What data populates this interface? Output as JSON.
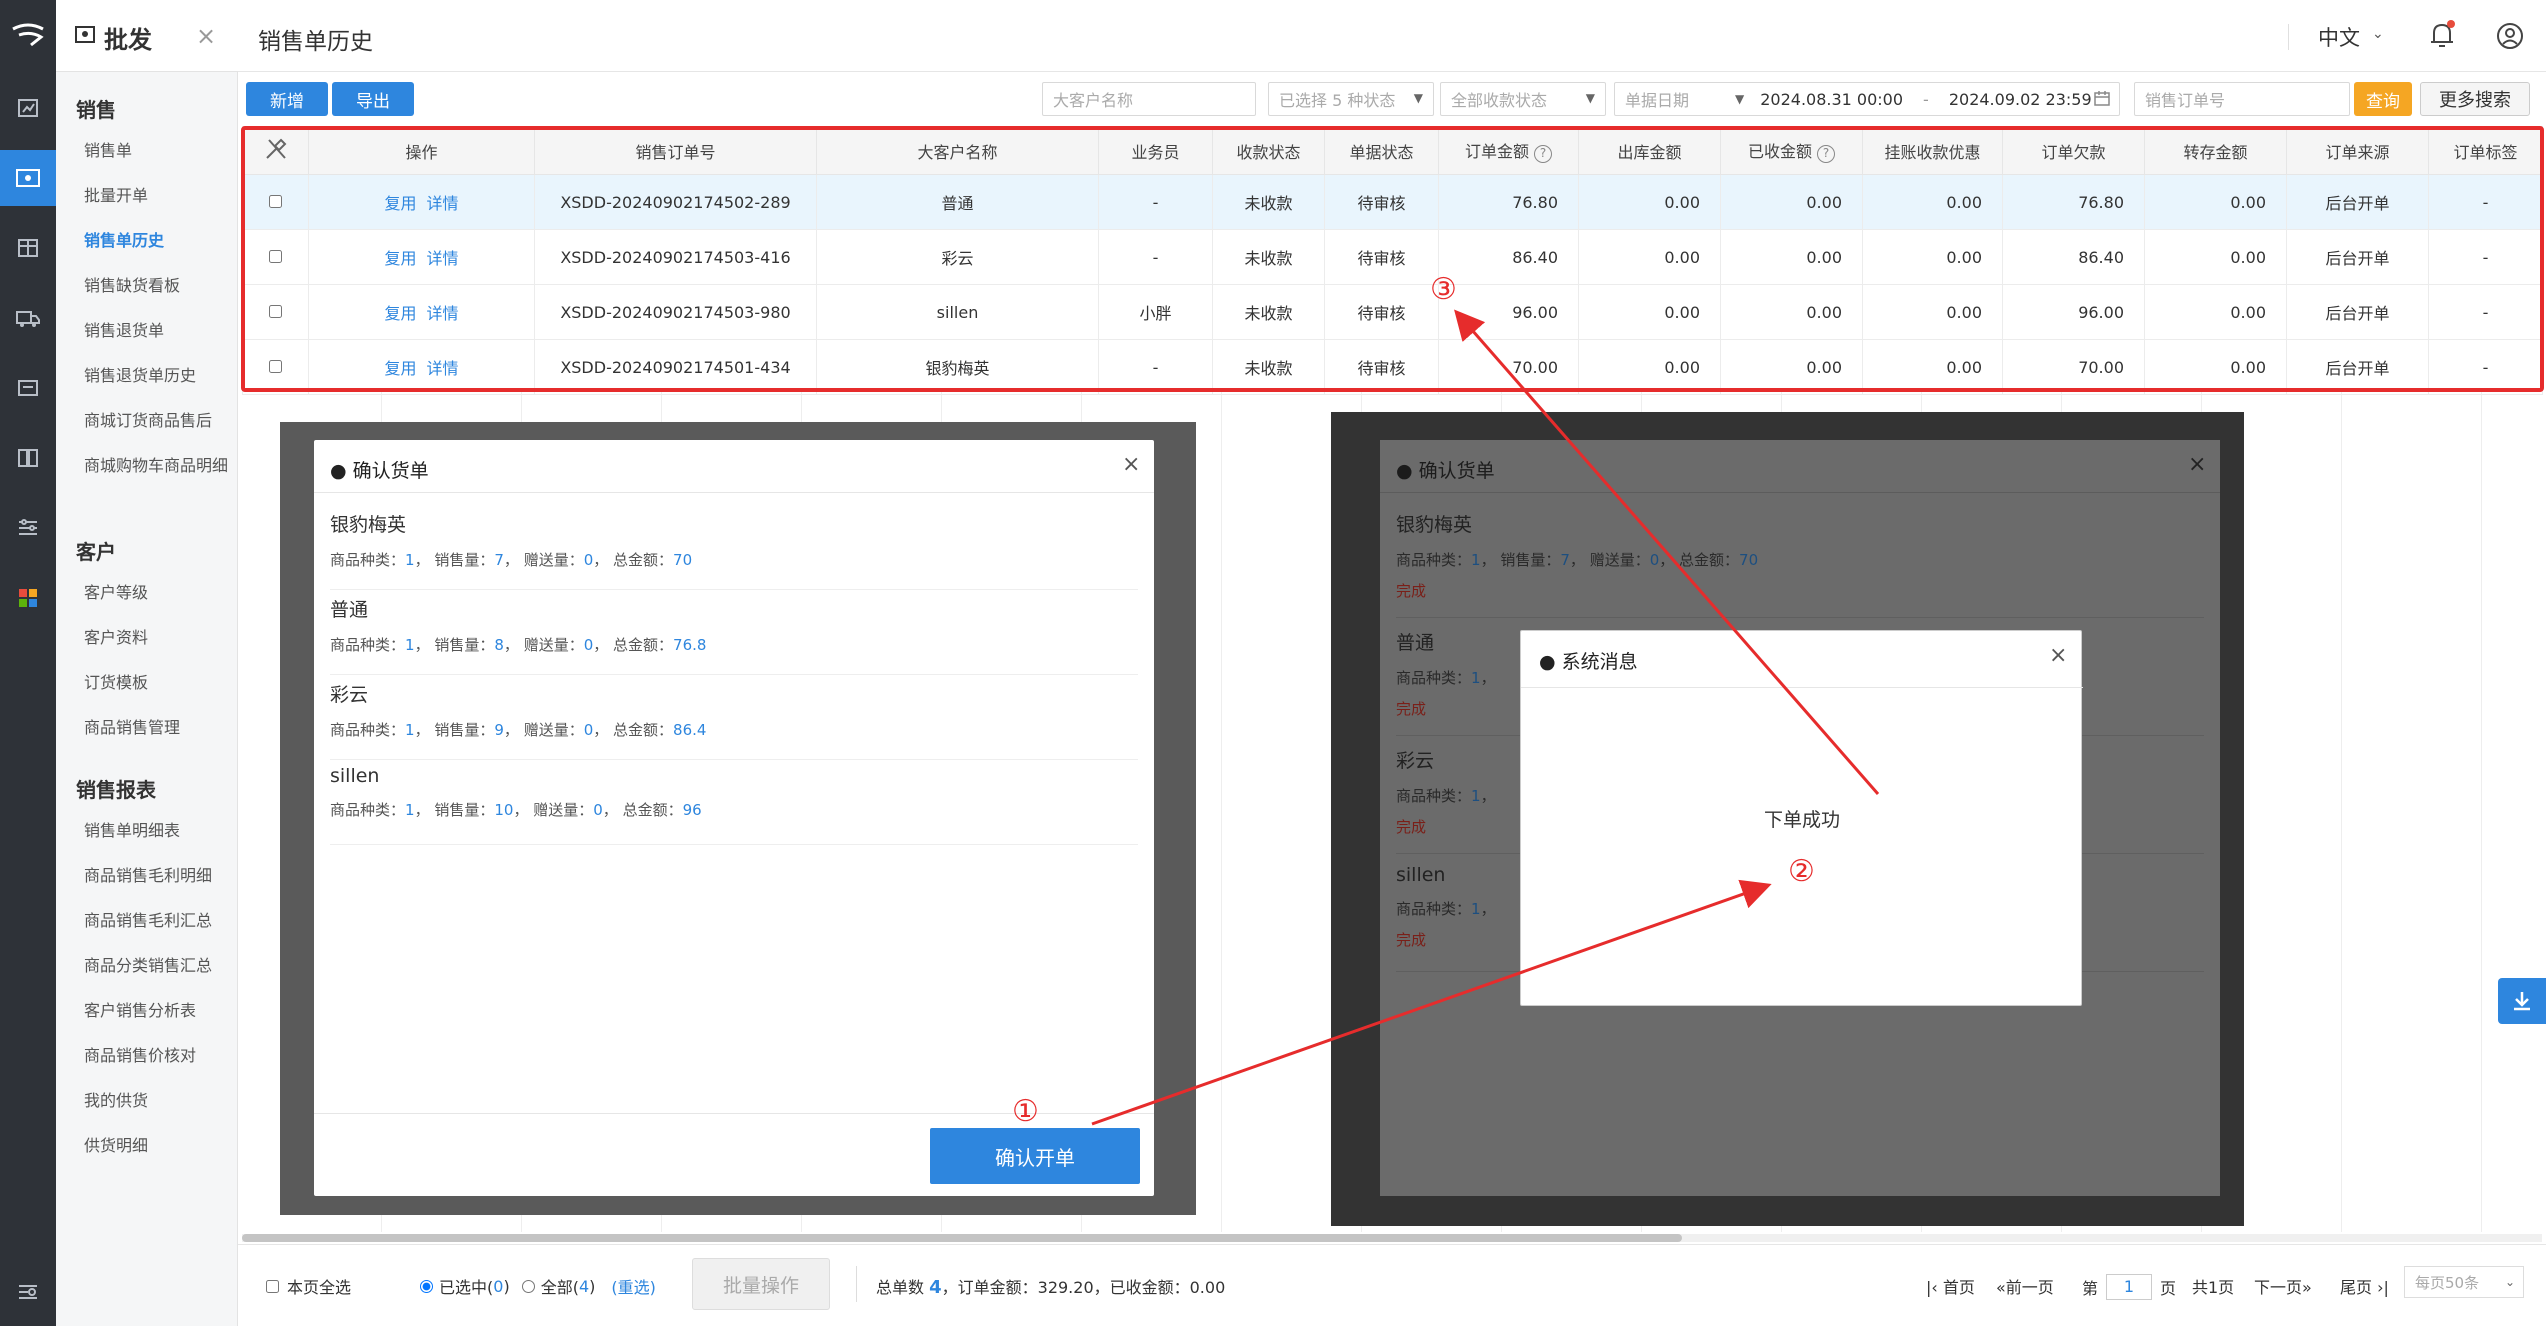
{
  "app": {
    "module_title": "批发",
    "lang": "中文"
  },
  "sidebar": {
    "groups": [
      {
        "title": "销售",
        "items": [
          "销售单",
          "批量开单",
          "销售单历史",
          "销售缺货看板",
          "销售退货单",
          "销售退货单历史",
          "商城订货商品售后",
          "商城购物车商品明细"
        ]
      },
      {
        "title": "客户",
        "items": [
          "客户等级",
          "客户资料",
          "订货模板",
          "商品销售管理"
        ]
      },
      {
        "title": "销售报表",
        "items": [
          "销售单明细表",
          "商品销售毛利明细",
          "商品销售毛利汇总",
          "商品分类销售汇总",
          "客户销售分析表",
          "商品销售价核对",
          "我的供货",
          "供货明细"
        ]
      }
    ]
  },
  "header": {
    "title": "销售单历史"
  },
  "toolbar": {
    "add_label": "新增",
    "export_label": "导出",
    "customer_placeholder": "大客户名称",
    "status_selected": "已选择 5 种状态",
    "payment_status": "全部收款状态",
    "date_type": "单据日期",
    "date_from": "2024.08.31 00:00",
    "date_sep": "-",
    "date_to": "2024.09.02 23:59",
    "order_no_placeholder": "销售订单号",
    "query_label": "查询",
    "more_search_label": "更多搜索"
  },
  "table": {
    "headers": [
      "",
      "操作",
      "销售订单号",
      "大客户名称",
      "业务员",
      "收款状态",
      "单据状态",
      "订单金额",
      "出库金额",
      "已收金额",
      "挂账收款优惠",
      "订单欠款",
      "转存金额",
      "订单来源",
      "订单标签"
    ],
    "action_reuse": "复用",
    "action_detail": "详情",
    "rows": [
      {
        "order_no": "XSDD-20240902174502-289",
        "customer": "普通",
        "salesman": "-",
        "pay_status": "未收款",
        "doc_status": "待审核",
        "amount": "76.80",
        "out_amount": "0.00",
        "received": "0.00",
        "discount": "0.00",
        "debt": "76.80",
        "transfer": "0.00",
        "source": "后台开单",
        "tag": "-"
      },
      {
        "order_no": "XSDD-20240902174503-416",
        "customer": "彩云",
        "salesman": "-",
        "pay_status": "未收款",
        "doc_status": "待审核",
        "amount": "86.40",
        "out_amount": "0.00",
        "received": "0.00",
        "discount": "0.00",
        "debt": "86.40",
        "transfer": "0.00",
        "source": "后台开单",
        "tag": "-"
      },
      {
        "order_no": "XSDD-20240902174503-980",
        "customer": "sillen",
        "salesman": "小胖",
        "pay_status": "未收款",
        "doc_status": "待审核",
        "amount": "96.00",
        "out_amount": "0.00",
        "received": "0.00",
        "discount": "0.00",
        "debt": "96.00",
        "transfer": "0.00",
        "source": "后台开单",
        "tag": "-"
      },
      {
        "order_no": "XSDD-20240902174501-434",
        "customer": "银豹梅英",
        "salesman": "-",
        "pay_status": "未收款",
        "doc_status": "待审核",
        "amount": "70.00",
        "out_amount": "0.00",
        "received": "0.00",
        "discount": "0.00",
        "debt": "70.00",
        "transfer": "0.00",
        "source": "后台开单",
        "tag": "-"
      }
    ]
  },
  "confirm_dialog": {
    "title": "● 确认货单",
    "customers": [
      {
        "name": "银豹梅英",
        "kinds": "1",
        "qty": "7",
        "gift": "0",
        "total": "70"
      },
      {
        "name": "普通",
        "kinds": "1",
        "qty": "8",
        "gift": "0",
        "total": "76.8"
      },
      {
        "name": "彩云",
        "kinds": "1",
        "qty": "9",
        "gift": "0",
        "total": "86.4"
      },
      {
        "name": "sillen",
        "kinds": "1",
        "qty": "10",
        "gift": "0",
        "total": "96"
      }
    ],
    "labels": {
      "kinds": "商品种类：",
      "qty": "销售量：",
      "gift": "赠送量：",
      "total": "总金额："
    },
    "confirm_label": "确认开单",
    "done_label": "完成"
  },
  "system_dialog": {
    "title": "● 系统消息",
    "message": "下单成功"
  },
  "annotations": {
    "step1": "①",
    "step2": "②",
    "step3": "③"
  },
  "footer": {
    "select_page": "本页全选",
    "selected": "已选中(",
    "selected_count": "0",
    "all": "全部(",
    "all_count": "4",
    "close_paren": ")",
    "reselect": "(重选)",
    "batch_label": "批量操作",
    "summary_prefix": "总单数",
    "summary_count": "4",
    "summary_rest": "，订单金额：329.20，已收金额：0.00",
    "first": "首页",
    "prev": "前一页",
    "page_prefix": "第",
    "page": "1",
    "page_suffix": "页",
    "total_pages": "共1页",
    "next": "下一页",
    "last": "尾页",
    "per_page": "每页50条"
  }
}
